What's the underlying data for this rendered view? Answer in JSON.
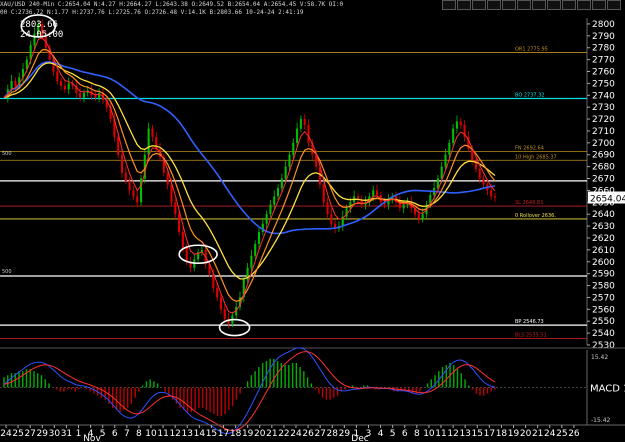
{
  "header": {
    "symbol_line": "XAU/USD  240-Min  C:2654.04  N:4.27  H:2664.27  L:2643.38  O:2649.52  B:2654.04  A:2654.45  V:58.7K  OI:0",
    "detail_line": "00  C:2736.72  N:1.77  H:2737.76  L:2725.76  O:2726.48  V:14.1K  B:2803.66  10-24-24  2:41:19"
  },
  "cursor_readout": {
    "price": "2803.66",
    "time": "24 05:00"
  },
  "toolbar_icons": [
    "window-icon",
    "window-icon",
    "window-icon",
    "window-icon",
    "window-icon",
    "window-icon",
    "window-icon",
    "window-icon",
    "window-icon",
    "window-icon",
    "window-icon",
    "window-icon"
  ],
  "colors": {
    "background": "#000000",
    "up_candle": "#00c000",
    "down_candle": "#e00000",
    "ema_fast": "#ff3030",
    "ema_mid": "#ff9020",
    "ema_slow": "#ffe040",
    "sma_long": "#3060ff",
    "level_cyan": "#00e0e0",
    "level_gold": "#c09020",
    "level_white": "#ffffff",
    "macd_line": "#3050ff",
    "signal_line": "#ff3030"
  },
  "chart_data": {
    "type": "line",
    "title": "",
    "price_axis": {
      "range": [
        2530,
        2805
      ],
      "ticks": [
        2800,
        2790,
        2780,
        2770,
        2760,
        2750,
        2740,
        2730,
        2720,
        2710,
        2700,
        2690,
        2680,
        2670,
        2660,
        2650,
        2640,
        2630,
        2620,
        2610,
        2600,
        2590,
        2580,
        2570,
        2560,
        2550,
        2540,
        2530
      ],
      "current_price": "2654.04"
    },
    "x_axis": {
      "ticks": [
        "24",
        "25",
        "27",
        "29",
        "30",
        "31",
        "1",
        "4",
        "5",
        "6",
        "7",
        "8",
        "10",
        "11",
        "12",
        "13",
        "14",
        "15",
        "17",
        "18",
        "19",
        "20",
        "21",
        "22",
        "24",
        "26",
        "27",
        "28",
        "29",
        "1",
        "3",
        "4",
        "5",
        "6",
        "8",
        "10",
        "11",
        "12",
        "13",
        "15",
        "17",
        "18",
        "19",
        "20",
        "21",
        "24",
        "25",
        "26"
      ],
      "month_labels": [
        "Nov",
        "Dec"
      ]
    },
    "levels": [
      {
        "label": "OR1 2775.95",
        "value": 2775.95,
        "color": "gold"
      },
      {
        "label": "BO 2737.32",
        "value": 2737.32,
        "color": "cyan"
      },
      {
        "label": "FN 2692.64",
        "value": 2692.64,
        "color": "gold"
      },
      {
        "label": "10 High 2685.37",
        "value": 2685.37,
        "color": "gold"
      },
      {
        "label": "",
        "value": 2668,
        "color": "white"
      },
      {
        "label": "SL 2646.83",
        "value": 2646.83,
        "color": "red"
      },
      {
        "label": "0 Rollover 2636.",
        "value": 2636,
        "color": "yellow"
      },
      {
        "label": "",
        "value": 2588,
        "color": "white"
      },
      {
        "label": "BP 2546.73",
        "value": 2546.73,
        "color": "white"
      },
      {
        "label": "BLS 2535.51",
        "value": 2535.51,
        "color": "red"
      }
    ],
    "left_level_labels": [
      {
        "label": "500",
        "value": 2688
      },
      {
        "label": "500",
        "value": 2589
      }
    ],
    "close_series": [
      2738,
      2745,
      2752,
      2748,
      2755,
      2762,
      2770,
      2782,
      2792,
      2800,
      2790,
      2780,
      2770,
      2760,
      2752,
      2748,
      2745,
      2750,
      2748,
      2742,
      2738,
      2742,
      2744,
      2740,
      2738,
      2742,
      2736,
      2730,
      2720,
      2705,
      2690,
      2675,
      2668,
      2660,
      2655,
      2650,
      2670,
      2690,
      2712,
      2705,
      2695,
      2688,
      2675,
      2665,
      2650,
      2640,
      2625,
      2612,
      2600,
      2595,
      2602,
      2608,
      2610,
      2598,
      2590,
      2578,
      2570,
      2560,
      2552,
      2548,
      2555,
      2562,
      2570,
      2585,
      2595,
      2605,
      2615,
      2625,
      2632,
      2640,
      2648,
      2655,
      2662,
      2670,
      2680,
      2690,
      2700,
      2712,
      2720,
      2715,
      2700,
      2690,
      2680,
      2665,
      2650,
      2640,
      2632,
      2628,
      2630,
      2638,
      2645,
      2650,
      2655,
      2652,
      2648,
      2650,
      2655,
      2660,
      2656,
      2650,
      2648,
      2652,
      2655,
      2650,
      2645,
      2648,
      2650,
      2645,
      2640,
      2636,
      2640,
      2648,
      2656,
      2662,
      2670,
      2680,
      2690,
      2700,
      2712,
      2718,
      2715,
      2705,
      2695,
      2685,
      2678,
      2670,
      2665,
      2660,
      2655,
      2654
    ],
    "macd": {
      "label": "MACD 1",
      "ticks": [
        "15.42",
        "0",
        "-15.42"
      ],
      "histogram": [
        5,
        6,
        7,
        7,
        8,
        8,
        9,
        9,
        8,
        7,
        6,
        4,
        2,
        0,
        -1,
        -2,
        -2,
        -1,
        -1,
        -2,
        -1,
        0,
        -1,
        -2,
        -3,
        -4,
        -5,
        -6,
        -8,
        -10,
        -11,
        -12,
        -11,
        -10,
        -8,
        -5,
        -2,
        1,
        3,
        4,
        3,
        2,
        0,
        -2,
        -4,
        -6,
        -8,
        -10,
        -11,
        -12,
        -12,
        -11,
        -10,
        -10,
        -11,
        -12,
        -13,
        -14,
        -14,
        -13,
        -11,
        -9,
        -6,
        -3,
        0,
        3,
        6,
        8,
        10,
        12,
        13,
        14,
        14,
        13,
        12,
        11,
        11,
        12,
        12,
        10,
        8,
        5,
        2,
        -1,
        -3,
        -5,
        -6,
        -6,
        -5,
        -4,
        -2,
        -1,
        0,
        1,
        0,
        0,
        1,
        1,
        0,
        -1,
        -1,
        0,
        0,
        -1,
        -2,
        -2,
        -1,
        -1,
        -2,
        -3,
        -3,
        -2,
        0,
        2,
        4,
        6,
        8,
        10,
        11,
        12,
        11,
        9,
        7,
        4,
        1,
        -1,
        -3,
        -4,
        -4,
        -3,
        -2,
        -1
      ]
    }
  }
}
